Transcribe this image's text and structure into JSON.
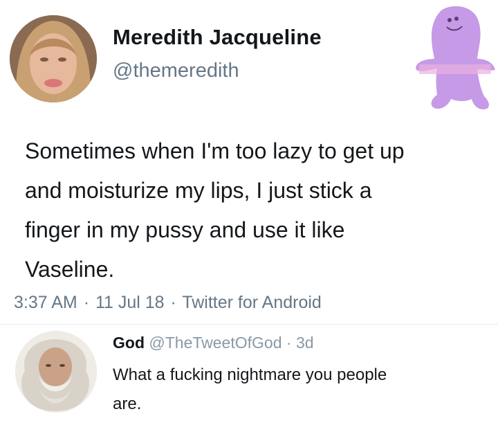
{
  "tweet": {
    "author": {
      "name": "Meredith Jacqueline",
      "handle": "@themeredith"
    },
    "text": "Sometimes when I'm too lazy to get up\nand moisturize my lips, I just stick a\nfinger in my pussy and use it like\nVaseline.",
    "meta": {
      "time": "3:37 AM",
      "date": "11 Jul 18",
      "source": "Twitter for Android",
      "separator": "·"
    }
  },
  "reply": {
    "name": "God",
    "handle": "@TheTweetOfGod",
    "separator": "·",
    "age": "3d",
    "text": "What a fucking nightmare you people\nare."
  },
  "colors": {
    "mascot": "#c69ae6",
    "text": "#14171a",
    "secondary": "#657786"
  }
}
